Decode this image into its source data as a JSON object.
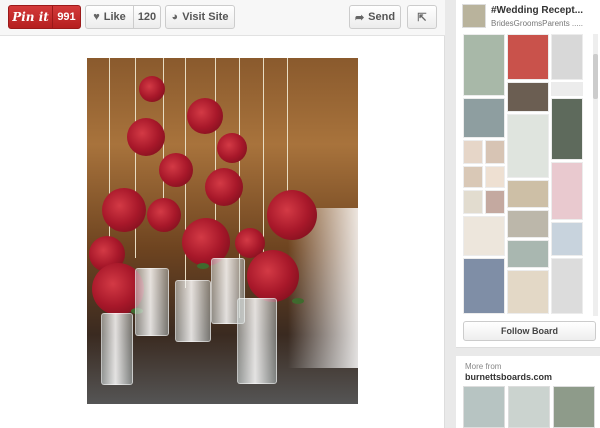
{
  "toolbar": {
    "pin_label": "Pin it",
    "pin_count": "991",
    "like_label": "Like",
    "like_count": "120",
    "visit_label": "Visit Site",
    "send_label": "Send"
  },
  "board": {
    "title": "#Wedding Recept...",
    "owner": "BridesGroomsParents .....",
    "follow_label": "Follow Board"
  },
  "more": {
    "label": "More from",
    "source": "burnettsboards.com"
  },
  "colors": {
    "pin_red": "#c62828",
    "wood_brown": "#8a5a2d",
    "rose_red": "#a8182a"
  }
}
